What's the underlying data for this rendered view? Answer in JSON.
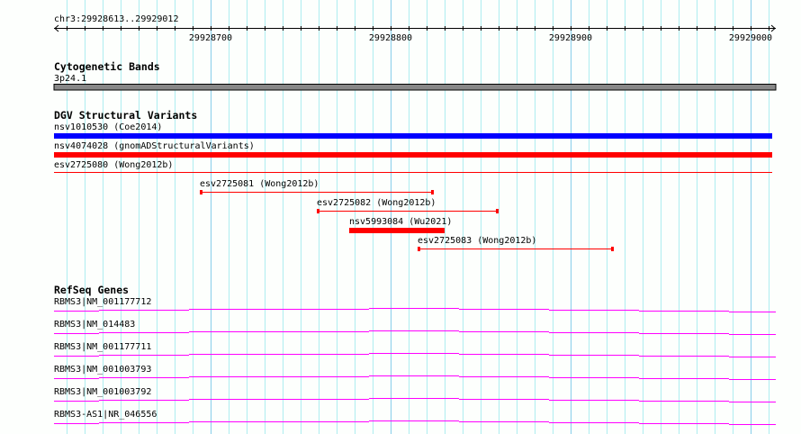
{
  "view": {
    "region_label": "chr3:29928613..29929012",
    "chrom": "chr3",
    "start": 29928613,
    "end": 29929012,
    "major_ticks": [
      "29928700",
      "29928800",
      "29928900",
      "29929000"
    ]
  },
  "tracks": {
    "cytoband": {
      "title": "Cytogenetic Bands",
      "band_label": "3p24.1",
      "color": "#888888"
    },
    "dgv": {
      "title": "DGV Structural Variants",
      "features": [
        {
          "label": "nsv1010530 (Coe2014)",
          "start": 29928613,
          "end": 29929012,
          "color": "#0000ff",
          "style": "thick"
        },
        {
          "label": "nsv4074028 (gnomADStructuralVariants)",
          "start": 29928613,
          "end": 29929012,
          "color": "#ff0000",
          "style": "thick"
        },
        {
          "label": "esv2725080 (Wong2012b)",
          "start": 29928613,
          "end": 29929012,
          "color": "#ff0000",
          "style": "thin"
        },
        {
          "label": "esv2725081 (Wong2012b)",
          "start": 29928694,
          "end": 29928824,
          "color": "#ff0000",
          "style": "capped"
        },
        {
          "label": "esv2725082 (Wong2012b)",
          "start": 29928759,
          "end": 29928860,
          "color": "#ff0000",
          "style": "capped"
        },
        {
          "label": "nsv5993084 (Wu2021)",
          "start": 29928777,
          "end": 29928830,
          "color": "#ff0000",
          "style": "thick"
        },
        {
          "label": "esv2725083 (Wong2012b)",
          "start": 29928815,
          "end": 29928924,
          "color": "#ff0000",
          "style": "capped"
        }
      ]
    },
    "refseq": {
      "title": "RefSeq Genes",
      "color": "#ff00ff",
      "genes": [
        {
          "label": "RBMS3|NM_001177712"
        },
        {
          "label": "RBMS3|NM_014483"
        },
        {
          "label": "RBMS3|NM_001177711"
        },
        {
          "label": "RBMS3|NM_001003793"
        },
        {
          "label": "RBMS3|NM_001003792"
        },
        {
          "label": "RBMS3-AS1|NR_046556"
        }
      ]
    }
  },
  "colors": {
    "grid_minor": "#aeeef0",
    "grid_major": "#87cdea"
  }
}
